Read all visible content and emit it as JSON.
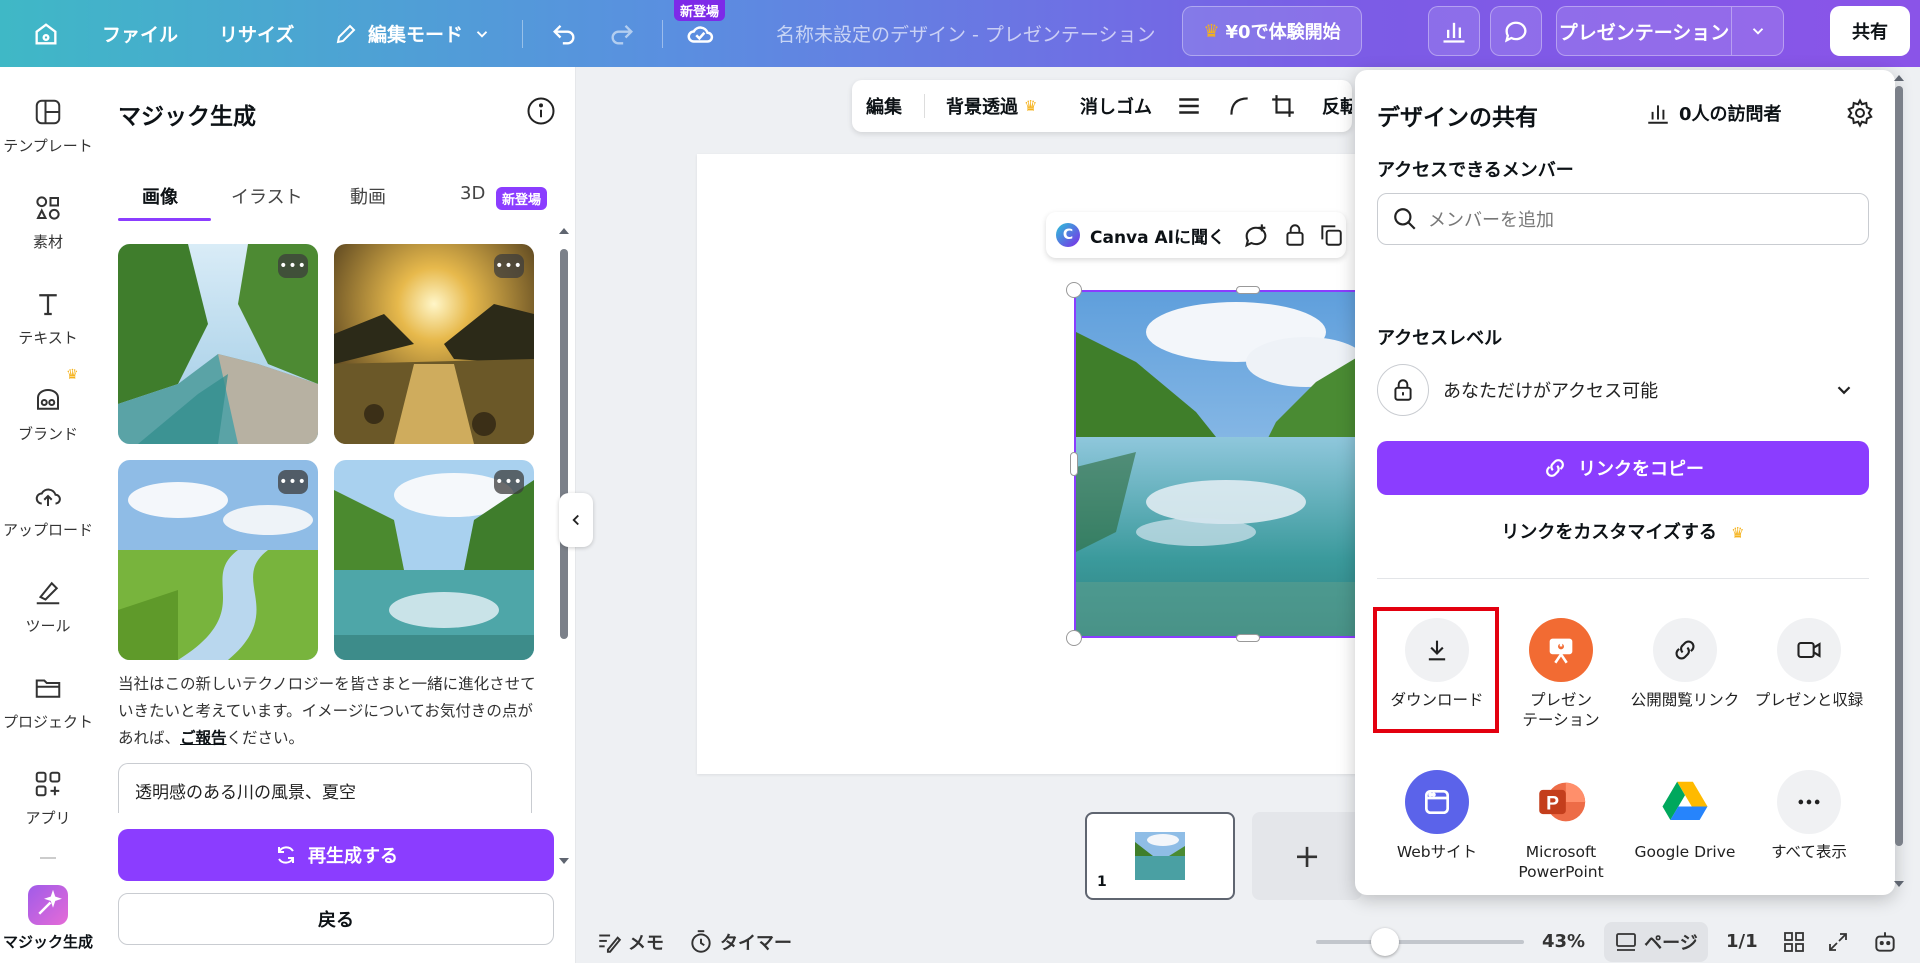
{
  "topbar": {
    "file": "ファイル",
    "resize": "リサイズ",
    "edit_mode": "編集モード",
    "new_badge": "新登場",
    "doc_title": "名称未設定のデザイン - プレゼンテーション",
    "trial": "¥0で体験開始",
    "present": "プレゼンテーション",
    "share": "共有"
  },
  "rail": {
    "items": [
      "テンプレート",
      "素材",
      "テキスト",
      "ブランド",
      "アップロード",
      "ツール",
      "プロジェクト",
      "アプリ",
      "マジック生成"
    ]
  },
  "panel": {
    "title": "マジック生成",
    "tabs": [
      "画像",
      "イラスト",
      "動画",
      "3D"
    ],
    "tab_new": "新登場",
    "disclaimer_pre": "当社はこの新しいテクノロジーを皆さまと一緒に進化させていきたいと考えています。イメージについてお気付きの点があれば、",
    "disclaimer_link": "ご報告",
    "disclaimer_post": "ください。",
    "prompt": "透明感のある川の風景、夏空",
    "regenerate": "再生成する",
    "back": "戻る"
  },
  "canvas": {
    "toolbar": [
      "編集",
      "背景透過",
      "消しゴム",
      "反転"
    ],
    "ai_ask": "Canva AIに聞く",
    "page_number": "1",
    "add_page": "+"
  },
  "bottombar": {
    "memo": "メモ",
    "timer": "タイマー",
    "zoom": "43%",
    "zoom_fraction": 0.33,
    "pages": "ページ",
    "page_count": "1/1"
  },
  "share_panel": {
    "title": "デザインの共有",
    "visitors": "0人の訪問者",
    "members_label": "アクセスできるメンバー",
    "search_placeholder": "メンバーを追加",
    "access_label": "アクセスレベル",
    "access_value": "あなただけがアクセス可能",
    "copy_link": "リンクをコピー",
    "customize_link": "リンクをカスタマイズする",
    "options": [
      {
        "label": "ダウンロード",
        "icon": "download-icon"
      },
      {
        "label": "プレゼン\nテーション",
        "icon": "presentation-icon"
      },
      {
        "label": "公開閲覧リンク",
        "icon": "link-icon"
      },
      {
        "label": "プレゼンと収録",
        "icon": "video-camera-icon"
      },
      {
        "label": "Webサイト",
        "icon": "website-icon"
      },
      {
        "label": "Microsoft\nPowerPoint",
        "icon": "powerpoint-icon"
      },
      {
        "label": "Google Drive",
        "icon": "google-drive-icon"
      },
      {
        "label": "すべて表示",
        "icon": "more-icon"
      }
    ]
  },
  "colors": {
    "accent": "#8b3dff",
    "highlight": "#e3000f",
    "crown": "#f5b21b"
  }
}
